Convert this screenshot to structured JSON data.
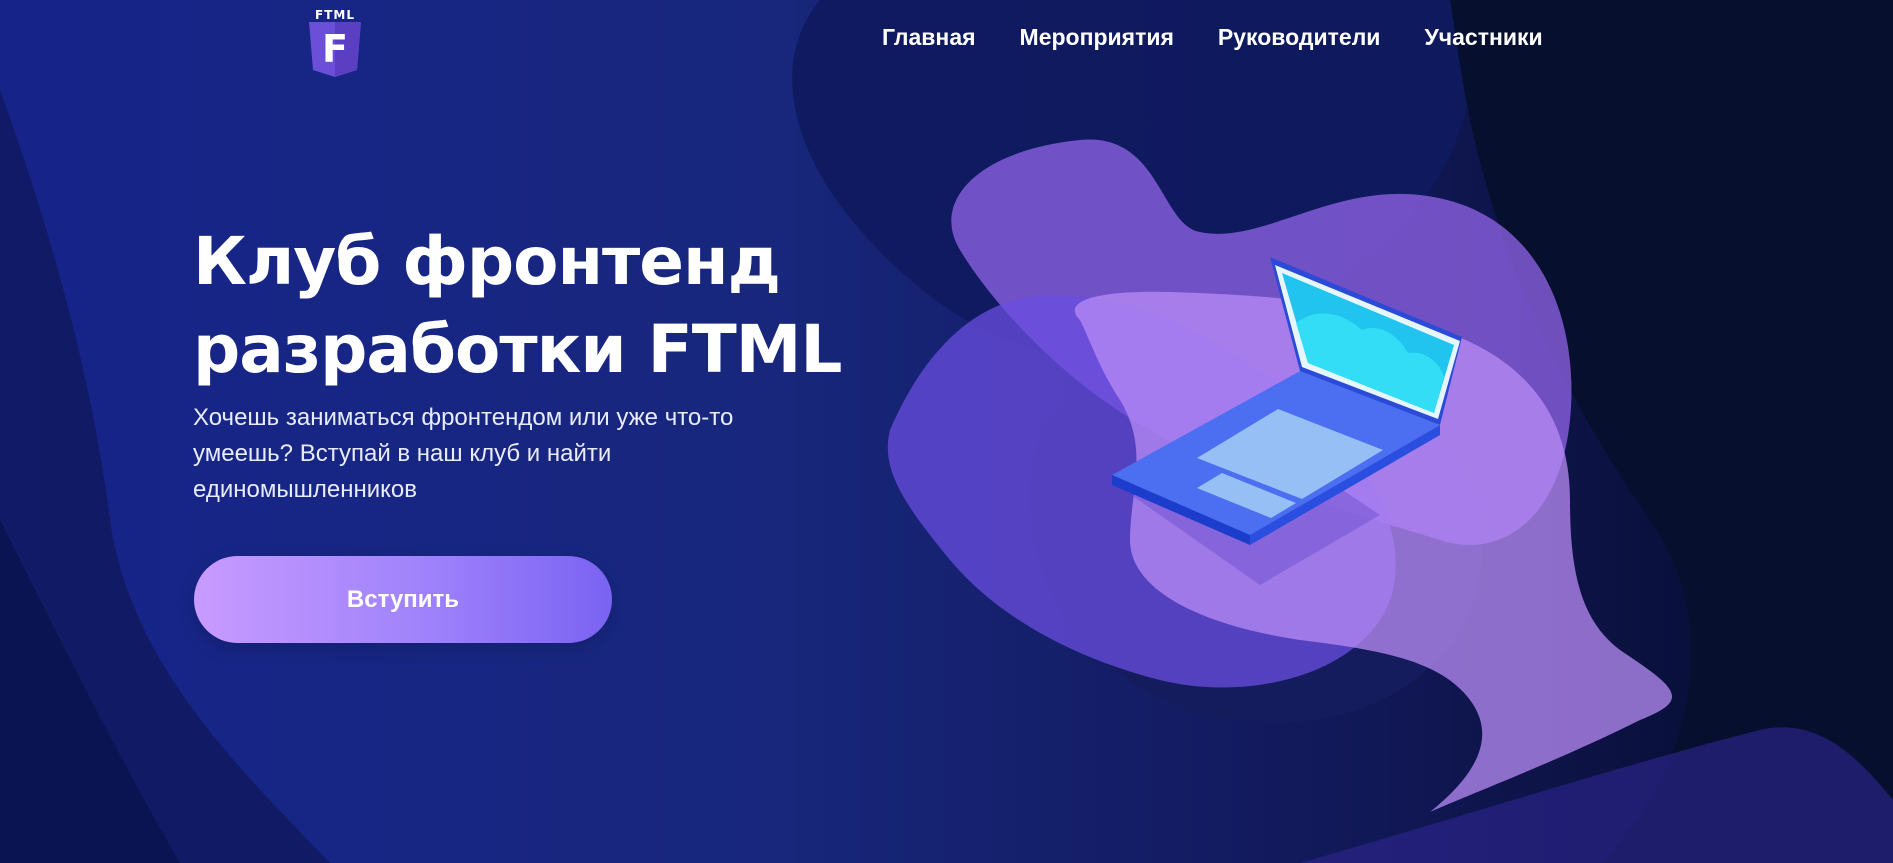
{
  "brand": {
    "logo_text": "FTML",
    "logo_letter": "F"
  },
  "nav": {
    "items": [
      {
        "label": "Главная"
      },
      {
        "label": "Мероприятия"
      },
      {
        "label": "Руководители"
      },
      {
        "label": "Участники"
      }
    ]
  },
  "hero": {
    "title_line1": "Клуб фронтенд",
    "title_line2": "разработки FTML",
    "subtitle_line1": "Хочешь заниматься фронтендом или уже что-то",
    "subtitle_line2": "умеешь? Вступай в наш клуб и найти",
    "subtitle_line3": "единомышленников",
    "cta_label": "Вступить"
  },
  "colors": {
    "background": "#16248a",
    "accent_purple": "#9f82fb",
    "laptop_screen": "#29c7f0",
    "text": "#ffffff"
  },
  "icons": {
    "logo": "ftml-shield-logo",
    "illustration": "laptop-illustration"
  }
}
